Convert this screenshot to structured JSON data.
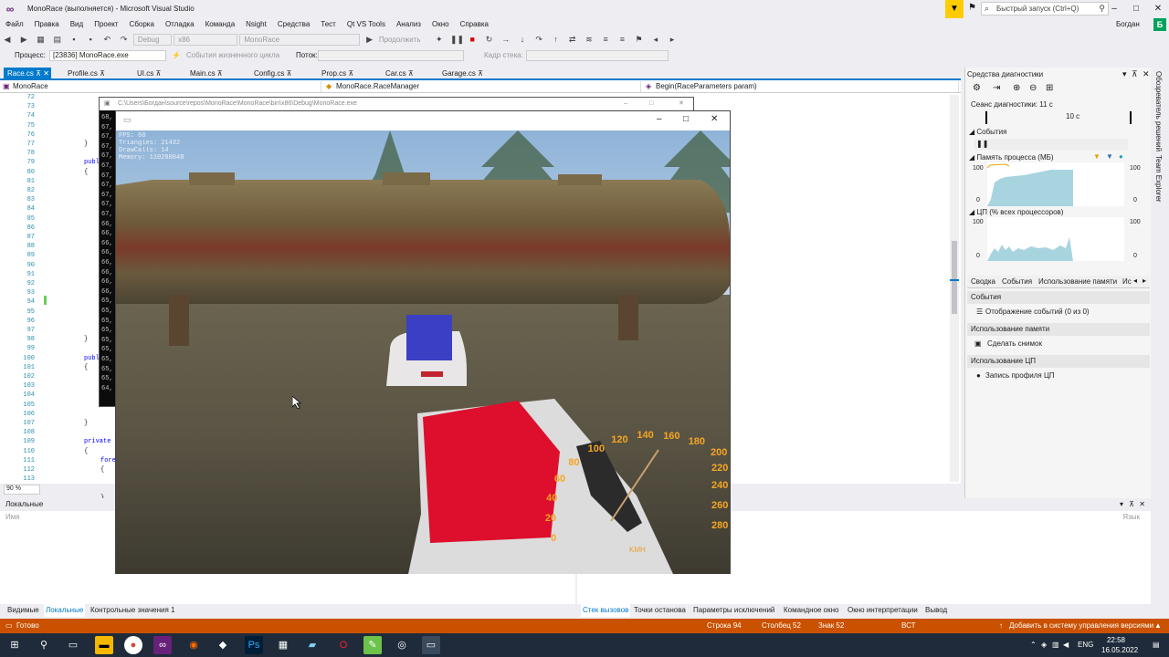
{
  "window": {
    "title": "MonoRace (выполняется) - Microsoft Visual Studio",
    "quick_launch_placeholder": "Быстрый запуск (Ctrl+Q)",
    "user_name": "Богдан",
    "user_initial": "Б"
  },
  "menu": [
    "Файл",
    "Правка",
    "Вид",
    "Проект",
    "Сборка",
    "Отладка",
    "Команда",
    "Nsight",
    "Средства",
    "Тест",
    "Qt VS Tools",
    "Анализ",
    "Окно",
    "Справка"
  ],
  "toolbar": {
    "config": "Debug",
    "platform": "x86",
    "project": "MonoRace",
    "continue_label": "Продолжить",
    "process_label": "Процесс:",
    "process_value": "[23836] MonoRace.exe",
    "lifecycle_label": "События жизненного цикла",
    "thread_label": "Поток:",
    "stack_frame_label": "Кадр стека:"
  },
  "tabs": [
    {
      "label": "Race.cs",
      "active": true
    },
    {
      "label": "Profile.cs",
      "active": false
    },
    {
      "label": "UI.cs",
      "active": false
    },
    {
      "label": "Main.cs",
      "active": false
    },
    {
      "label": "Config.cs",
      "active": false
    },
    {
      "label": "Prop.cs",
      "active": false
    },
    {
      "label": "Car.cs",
      "active": false
    },
    {
      "label": "Garage.cs",
      "active": false
    }
  ],
  "navbar": {
    "project": "MonoRace",
    "class": "MonoRace.RaceManager",
    "method": "Begin(RaceParameters param)"
  },
  "editor": {
    "line_numbers": [
      "72",
      "73",
      "74",
      "75",
      "76",
      "77",
      "78",
      "79",
      "80",
      "81",
      "82",
      "83",
      "84",
      "85",
      "86",
      "87",
      "88",
      "89",
      "90",
      "91",
      "92",
      "93",
      "94",
      "95",
      "96",
      "97",
      "98",
      "99",
      "100",
      "101",
      "102",
      "103",
      "104",
      "105",
      "106",
      "107",
      "108",
      "109",
      "110",
      "111",
      "112",
      "113"
    ],
    "code_fragments": [
      {
        "line": 5,
        "text": "}"
      },
      {
        "line": 7,
        "text": "publ"
      },
      {
        "line": 8,
        "text": "{"
      },
      {
        "line": 26,
        "text": "}"
      },
      {
        "line": 28,
        "text": "publ"
      },
      {
        "line": 29,
        "text": "{"
      },
      {
        "line": 35,
        "text": "}"
      },
      {
        "line": 37,
        "text": "private"
      },
      {
        "line": 38,
        "text": "{"
      },
      {
        "line": 39,
        "text": "fore"
      },
      {
        "line": 40,
        "text": "{"
      },
      {
        "line": 43,
        "text": "}"
      }
    ],
    "zoom": "90 %"
  },
  "console": {
    "title": "C:\\Users\\Богдан\\source\\repos\\MonoRace\\MonoRace\\bin\\x86\\Debug\\MonoRace.exe",
    "lines": [
      "68,",
      "67,",
      "67,",
      "67,",
      "67,",
      "67,",
      "67,",
      "67,",
      "67,",
      "67,",
      "67,",
      "66,",
      "66,",
      "66,",
      "66,",
      "66,",
      "66,",
      "66,",
      "66,",
      "65,",
      "65,",
      "65,",
      "65,",
      "65,",
      "65,",
      "65,",
      "65,",
      "65,",
      "64,"
    ]
  },
  "game": {
    "hud_lines": [
      "FPS: 60",
      "Triangles: 21432",
      "DrawCalls: 14",
      "Memory: 110280048"
    ],
    "speed_labels": [
      "0",
      "20",
      "40",
      "60",
      "80",
      "100",
      "120",
      "140",
      "160",
      "180",
      "200",
      "220",
      "240",
      "260",
      "280"
    ],
    "speed_unit": "KMH"
  },
  "diagnostics": {
    "title": "Средства диагностики",
    "session_label": "Сеанс диагностики: 11 с",
    "timeline_label": "10 с",
    "events_header": "События",
    "memory_header": "Память процесса (МБ)",
    "memory_max": "100",
    "memory_min": "0",
    "cpu_header": "ЦП (% всех процессоров)",
    "cpu_max": "100",
    "cpu_min": "0",
    "tabs": [
      "Сводка",
      "События",
      "Использование памяти",
      "Ис"
    ],
    "section_events": "События",
    "show_events": "Отображение событий (0 из 0)",
    "section_memory": "Использование памяти",
    "snapshot": "Сделать снимок",
    "section_cpu": "Использование ЦП",
    "cpu_record": "Запись профиля ЦП"
  },
  "right_tabs": [
    "Обозреватель решений",
    "Team Explorer"
  ],
  "locals": {
    "title": "Локальные",
    "col_name": "Имя",
    "tabs": [
      "Видимые",
      "Локальные",
      "Контрольные значения 1"
    ]
  },
  "callstack": {
    "col_lang": "Язык",
    "tabs": [
      "Стек вызовов",
      "Точки останова",
      "Параметры исключений",
      "Командное окно",
      "Окно интерпретации",
      "Вывод"
    ]
  },
  "statusbar": {
    "ready": "Готово",
    "row": "Строка 94",
    "col": "Столбец 52",
    "char": "Знак 52",
    "ins": "ВСТ",
    "vcs": "Добавить в систему управления версиями"
  },
  "taskbar": {
    "lang": "ENG",
    "time": "22:58",
    "date": "16.05.2022"
  },
  "colors": {
    "accent": "#007acc",
    "statusbar": "#ca5100",
    "taskbar": "#1f2b3a"
  }
}
